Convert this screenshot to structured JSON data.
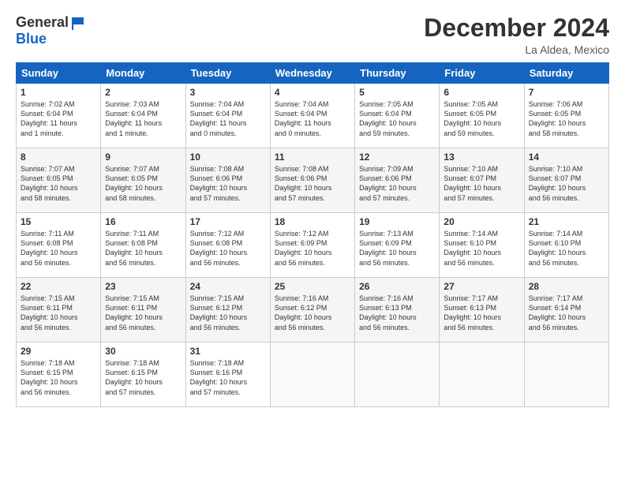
{
  "logo": {
    "general": "General",
    "blue": "Blue"
  },
  "title": "December 2024",
  "location": "La Aldea, Mexico",
  "days_header": [
    "Sunday",
    "Monday",
    "Tuesday",
    "Wednesday",
    "Thursday",
    "Friday",
    "Saturday"
  ],
  "weeks": [
    [
      {
        "day": "1",
        "info": "Sunrise: 7:02 AM\nSunset: 6:04 PM\nDaylight: 11 hours\nand 1 minute."
      },
      {
        "day": "2",
        "info": "Sunrise: 7:03 AM\nSunset: 6:04 PM\nDaylight: 11 hours\nand 1 minute."
      },
      {
        "day": "3",
        "info": "Sunrise: 7:04 AM\nSunset: 6:04 PM\nDaylight: 11 hours\nand 0 minutes."
      },
      {
        "day": "4",
        "info": "Sunrise: 7:04 AM\nSunset: 6:04 PM\nDaylight: 11 hours\nand 0 minutes."
      },
      {
        "day": "5",
        "info": "Sunrise: 7:05 AM\nSunset: 6:04 PM\nDaylight: 10 hours\nand 59 minutes."
      },
      {
        "day": "6",
        "info": "Sunrise: 7:05 AM\nSunset: 6:05 PM\nDaylight: 10 hours\nand 59 minutes."
      },
      {
        "day": "7",
        "info": "Sunrise: 7:06 AM\nSunset: 6:05 PM\nDaylight: 10 hours\nand 58 minutes."
      }
    ],
    [
      {
        "day": "8",
        "info": "Sunrise: 7:07 AM\nSunset: 6:05 PM\nDaylight: 10 hours\nand 58 minutes."
      },
      {
        "day": "9",
        "info": "Sunrise: 7:07 AM\nSunset: 6:05 PM\nDaylight: 10 hours\nand 58 minutes."
      },
      {
        "day": "10",
        "info": "Sunrise: 7:08 AM\nSunset: 6:06 PM\nDaylight: 10 hours\nand 57 minutes."
      },
      {
        "day": "11",
        "info": "Sunrise: 7:08 AM\nSunset: 6:06 PM\nDaylight: 10 hours\nand 57 minutes."
      },
      {
        "day": "12",
        "info": "Sunrise: 7:09 AM\nSunset: 6:06 PM\nDaylight: 10 hours\nand 57 minutes."
      },
      {
        "day": "13",
        "info": "Sunrise: 7:10 AM\nSunset: 6:07 PM\nDaylight: 10 hours\nand 57 minutes."
      },
      {
        "day": "14",
        "info": "Sunrise: 7:10 AM\nSunset: 6:07 PM\nDaylight: 10 hours\nand 56 minutes."
      }
    ],
    [
      {
        "day": "15",
        "info": "Sunrise: 7:11 AM\nSunset: 6:08 PM\nDaylight: 10 hours\nand 56 minutes."
      },
      {
        "day": "16",
        "info": "Sunrise: 7:11 AM\nSunset: 6:08 PM\nDaylight: 10 hours\nand 56 minutes."
      },
      {
        "day": "17",
        "info": "Sunrise: 7:12 AM\nSunset: 6:08 PM\nDaylight: 10 hours\nand 56 minutes."
      },
      {
        "day": "18",
        "info": "Sunrise: 7:12 AM\nSunset: 6:09 PM\nDaylight: 10 hours\nand 56 minutes."
      },
      {
        "day": "19",
        "info": "Sunrise: 7:13 AM\nSunset: 6:09 PM\nDaylight: 10 hours\nand 56 minutes."
      },
      {
        "day": "20",
        "info": "Sunrise: 7:14 AM\nSunset: 6:10 PM\nDaylight: 10 hours\nand 56 minutes."
      },
      {
        "day": "21",
        "info": "Sunrise: 7:14 AM\nSunset: 6:10 PM\nDaylight: 10 hours\nand 56 minutes."
      }
    ],
    [
      {
        "day": "22",
        "info": "Sunrise: 7:15 AM\nSunset: 6:11 PM\nDaylight: 10 hours\nand 56 minutes."
      },
      {
        "day": "23",
        "info": "Sunrise: 7:15 AM\nSunset: 6:11 PM\nDaylight: 10 hours\nand 56 minutes."
      },
      {
        "day": "24",
        "info": "Sunrise: 7:15 AM\nSunset: 6:12 PM\nDaylight: 10 hours\nand 56 minutes."
      },
      {
        "day": "25",
        "info": "Sunrise: 7:16 AM\nSunset: 6:12 PM\nDaylight: 10 hours\nand 56 minutes."
      },
      {
        "day": "26",
        "info": "Sunrise: 7:16 AM\nSunset: 6:13 PM\nDaylight: 10 hours\nand 56 minutes."
      },
      {
        "day": "27",
        "info": "Sunrise: 7:17 AM\nSunset: 6:13 PM\nDaylight: 10 hours\nand 56 minutes."
      },
      {
        "day": "28",
        "info": "Sunrise: 7:17 AM\nSunset: 6:14 PM\nDaylight: 10 hours\nand 56 minutes."
      }
    ],
    [
      {
        "day": "29",
        "info": "Sunrise: 7:18 AM\nSunset: 6:15 PM\nDaylight: 10 hours\nand 56 minutes."
      },
      {
        "day": "30",
        "info": "Sunrise: 7:18 AM\nSunset: 6:15 PM\nDaylight: 10 hours\nand 57 minutes."
      },
      {
        "day": "31",
        "info": "Sunrise: 7:18 AM\nSunset: 6:16 PM\nDaylight: 10 hours\nand 57 minutes."
      },
      null,
      null,
      null,
      null
    ]
  ]
}
